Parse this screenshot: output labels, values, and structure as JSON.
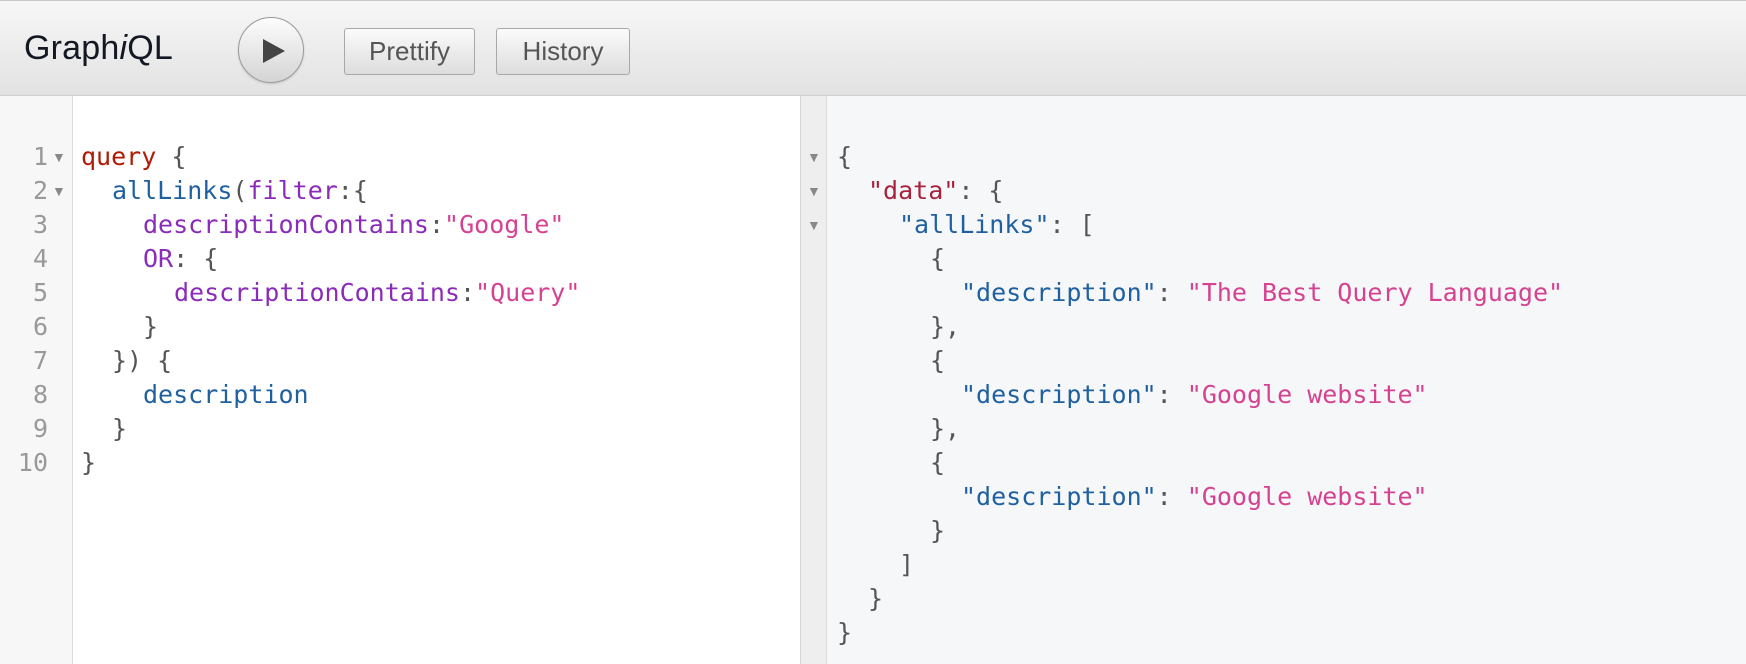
{
  "toolbar": {
    "logo_pre": "Graph",
    "logo_i": "i",
    "logo_post": "QL",
    "prettify_label": "Prettify",
    "history_label": "History"
  },
  "query_lines": [
    {
      "num": "1",
      "fold": true,
      "indent": 0,
      "tokens": [
        [
          "kw",
          "query"
        ],
        [
          "pun",
          " {"
        ]
      ]
    },
    {
      "num": "2",
      "fold": true,
      "indent": 1,
      "tokens": [
        [
          "fld",
          "allLinks"
        ],
        [
          "pun",
          "("
        ],
        [
          "arg",
          "filter"
        ],
        [
          "pun",
          ":{"
        ]
      ]
    },
    {
      "num": "3",
      "fold": false,
      "indent": 2,
      "tokens": [
        [
          "arg",
          "descriptionContains"
        ],
        [
          "pun",
          ":"
        ],
        [
          "str",
          "\"Google\""
        ]
      ]
    },
    {
      "num": "4",
      "fold": false,
      "indent": 2,
      "tokens": [
        [
          "arg",
          "OR"
        ],
        [
          "pun",
          ": {"
        ]
      ]
    },
    {
      "num": "5",
      "fold": false,
      "indent": 3,
      "tokens": [
        [
          "arg",
          "descriptionContains"
        ],
        [
          "pun",
          ":"
        ],
        [
          "str",
          "\"Query\""
        ]
      ]
    },
    {
      "num": "6",
      "fold": false,
      "indent": 2,
      "tokens": [
        [
          "pun",
          "}"
        ]
      ]
    },
    {
      "num": "7",
      "fold": false,
      "indent": 1,
      "tokens": [
        [
          "pun",
          "}) {"
        ]
      ]
    },
    {
      "num": "8",
      "fold": false,
      "indent": 2,
      "tokens": [
        [
          "fld",
          "description"
        ]
      ]
    },
    {
      "num": "9",
      "fold": false,
      "indent": 1,
      "tokens": [
        [
          "pun",
          "}"
        ]
      ]
    },
    {
      "num": "10",
      "fold": false,
      "indent": 0,
      "tokens": [
        [
          "pun",
          "}"
        ]
      ]
    }
  ],
  "result_lines": [
    {
      "fold": true,
      "indent": 0,
      "tokens": [
        [
          "rpun",
          "{"
        ]
      ]
    },
    {
      "fold": true,
      "indent": 1,
      "tokens": [
        [
          "prop",
          "\"data\""
        ],
        [
          "rpun",
          ": {"
        ]
      ]
    },
    {
      "fold": true,
      "indent": 2,
      "tokens": [
        [
          "rkey",
          "\"allLinks\""
        ],
        [
          "rpun",
          ": ["
        ]
      ]
    },
    {
      "fold": false,
      "indent": 3,
      "tokens": [
        [
          "rpun",
          "{"
        ]
      ]
    },
    {
      "fold": false,
      "indent": 4,
      "tokens": [
        [
          "rkey",
          "\"description\""
        ],
        [
          "rpun",
          ": "
        ],
        [
          "rstr",
          "\"The Best Query Language\""
        ]
      ]
    },
    {
      "fold": false,
      "indent": 3,
      "tokens": [
        [
          "rpun",
          "},"
        ]
      ]
    },
    {
      "fold": false,
      "indent": 3,
      "tokens": [
        [
          "rpun",
          "{"
        ]
      ]
    },
    {
      "fold": false,
      "indent": 4,
      "tokens": [
        [
          "rkey",
          "\"description\""
        ],
        [
          "rpun",
          ": "
        ],
        [
          "rstr",
          "\"Google website\""
        ]
      ]
    },
    {
      "fold": false,
      "indent": 3,
      "tokens": [
        [
          "rpun",
          "},"
        ]
      ]
    },
    {
      "fold": false,
      "indent": 3,
      "tokens": [
        [
          "rpun",
          "{"
        ]
      ]
    },
    {
      "fold": false,
      "indent": 4,
      "tokens": [
        [
          "rkey",
          "\"description\""
        ],
        [
          "rpun",
          ": "
        ],
        [
          "rstr",
          "\"Google website\""
        ]
      ]
    },
    {
      "fold": false,
      "indent": 3,
      "tokens": [
        [
          "rpun",
          "}"
        ]
      ]
    },
    {
      "fold": false,
      "indent": 2,
      "tokens": [
        [
          "rpun",
          "]"
        ]
      ]
    },
    {
      "fold": false,
      "indent": 1,
      "tokens": [
        [
          "rpun",
          "}"
        ]
      ]
    },
    {
      "fold": false,
      "indent": 0,
      "tokens": [
        [
          "rpun",
          "}"
        ]
      ]
    }
  ]
}
